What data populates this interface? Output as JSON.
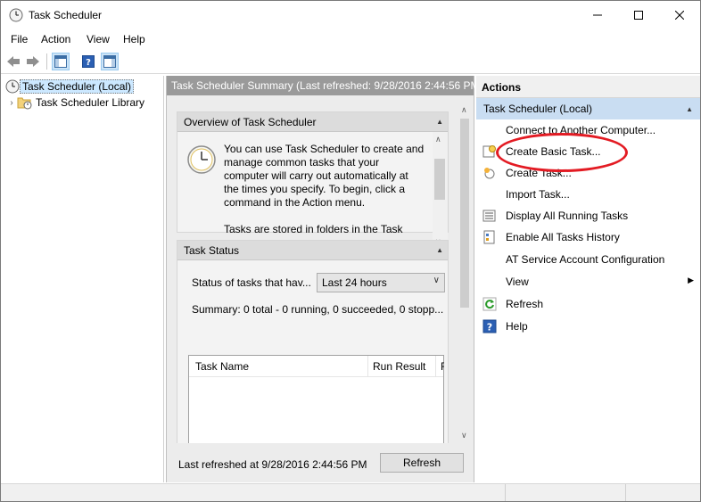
{
  "window": {
    "title": "Task Scheduler"
  },
  "menu": {
    "items": [
      "File",
      "Action",
      "View",
      "Help"
    ]
  },
  "tree": {
    "root": "Task Scheduler (Local)",
    "child": "Task Scheduler Library"
  },
  "middle": {
    "header": "Task Scheduler Summary (Last refreshed: 9/28/2016 2:44:56 PM)",
    "overview": {
      "title": "Overview of Task Scheduler",
      "lines": [
        "You can use Task Scheduler to create and",
        "manage common tasks that your",
        "computer will carry out automatically at",
        "the times you specify. To begin, click a",
        "command in the Action menu.",
        "",
        "Tasks are stored in folders in the Task"
      ]
    },
    "status": {
      "title": "Task Status",
      "label": "Status of tasks that hav...",
      "selected_range": "Last 24 hours",
      "summary": "Summary: 0 total - 0 running, 0 succeeded, 0 stopp...",
      "columns": [
        "Task Name",
        "Run Result",
        "R"
      ]
    },
    "footer": {
      "last_refreshed": "Last refreshed at 9/28/2016 2:44:56 PM",
      "refresh_label": "Refresh"
    }
  },
  "actions": {
    "title": "Actions",
    "group": "Task Scheduler (Local)",
    "items": [
      {
        "label": "Connect to Another Computer...",
        "icon": "none"
      },
      {
        "label": "Create Basic Task...",
        "icon": "create-basic-task-icon"
      },
      {
        "label": "Create Task...",
        "icon": "create-task-icon"
      },
      {
        "label": "Import Task...",
        "icon": "none"
      },
      {
        "label": "Display All Running Tasks",
        "icon": "running-tasks-icon"
      },
      {
        "label": "Enable All Tasks History",
        "icon": "tasks-history-icon"
      },
      {
        "label": "AT Service Account Configuration",
        "icon": "none"
      },
      {
        "label": "View",
        "icon": "none"
      },
      {
        "label": "Refresh",
        "icon": "refresh-icon"
      },
      {
        "label": "Help",
        "icon": "help-icon"
      }
    ]
  },
  "colors": {
    "highlight_oval": "#e31b23",
    "group_header": "#c9ddf2",
    "middle_header": "#9a9a9a"
  }
}
